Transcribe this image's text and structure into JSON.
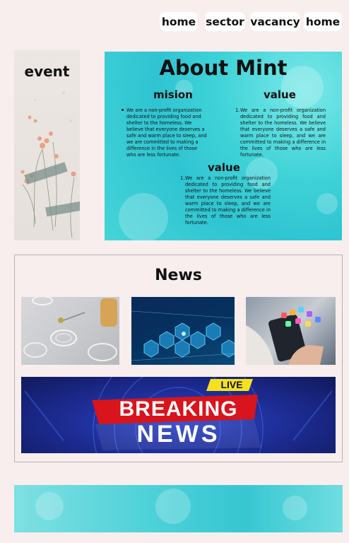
{
  "nav": {
    "items": [
      "home",
      "sector",
      "vacancy",
      "home"
    ]
  },
  "event": {
    "title": "event"
  },
  "about": {
    "title": "About Mint",
    "mission": {
      "heading": "mision",
      "text": "We are a non-profit organization dedicated to providing food and shelter to the homeless. We believe that everyone deserves a safe and warm place to sleep, and we are committed to making a difference in the lives of those who are less fortunate."
    },
    "value_right": {
      "heading": "value",
      "text": "We are a non-profit organization dedicated to providing food and shelter to the homeless. We believe that everyone deserves a safe and warm place to sleep, and we are committed to making a difference in the lives of those who are less fortunate."
    },
    "value_center": {
      "heading": "value",
      "text": "We are a non-profit organization dedicated to providing food and shelter to the homeless. We believe that everyone deserves a safe and warm place to sleep, and we are committed to making a difference in the lives of those who are less fortunate."
    }
  },
  "news": {
    "title": "News",
    "banner": {
      "live": "LIVE",
      "breaking": "BREAKING",
      "news": "NEWS"
    }
  },
  "colors": {
    "background": "#f8eeee",
    "teal": "#3fd3d8",
    "banner_red": "#d8141c",
    "banner_blue": "#1c2a8f",
    "live_yellow": "#f4e21e"
  }
}
